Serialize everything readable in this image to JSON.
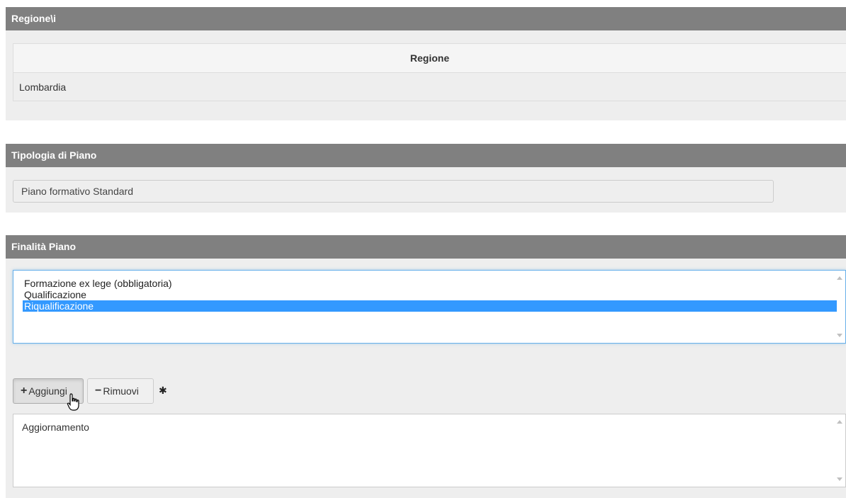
{
  "regione_panel": {
    "title": "Regione\\i",
    "column_header": "Regione",
    "rows": [
      "Lombardia"
    ]
  },
  "tipologia_panel": {
    "title": "Tipologia di Piano",
    "value": "Piano formativo Standard"
  },
  "finalita_panel": {
    "title": "Finalità Piano",
    "options": [
      {
        "label": "Formazione ex lege (obbligatoria)",
        "selected": false
      },
      {
        "label": "Qualificazione",
        "selected": false
      },
      {
        "label": "Riqualificazione",
        "selected": true
      }
    ],
    "add_label": "Aggiungi",
    "add_icon": "plus-icon",
    "remove_label": "Rimuovi",
    "remove_icon": "minus-icon",
    "required_marker": "✱",
    "selected_items": [
      "Aggiornamento"
    ]
  },
  "colors": {
    "header_bg": "#808080",
    "panel_bg": "#eeeeee",
    "selection": "#3399ff"
  }
}
